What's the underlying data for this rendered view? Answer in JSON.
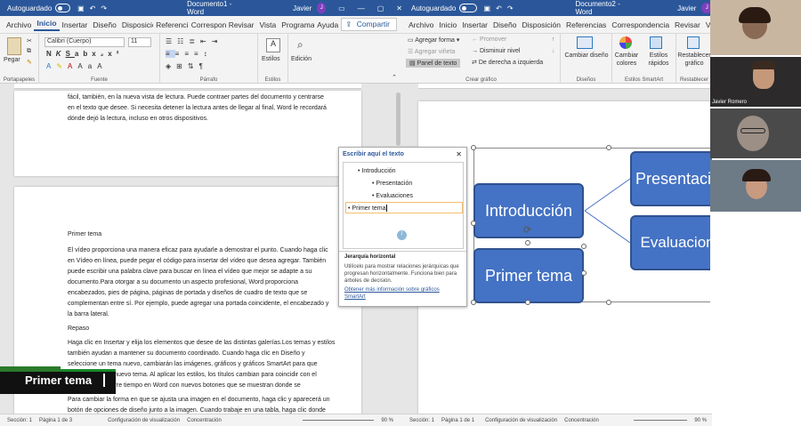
{
  "left": {
    "autosave": "Autoguardado",
    "doc_title": "Documento1 - Word",
    "user": "Javier",
    "user_initial": "J",
    "tabs": [
      "Archivo",
      "Inicio",
      "Insertar",
      "Diseño",
      "Disposición",
      "Referencias",
      "Correspondencia",
      "Revisar",
      "Vista",
      "Programador",
      "Ayuda"
    ],
    "active_tab": "Inicio",
    "share": "Compartir",
    "ribbon": {
      "paste": "Pegar",
      "font": "Calibri (Cuerpo)",
      "size": "11",
      "styles": "Estilos",
      "edit": "Edición",
      "groups": [
        "Portapapeles",
        "Fuente",
        "Párrafo",
        "Estilos"
      ]
    },
    "doc_top_lines": [
      "fácil, también, en la nueva vista de lectura. Puede contraer partes del documento y centrarse",
      "en el texto que desee. Si necesita detener la lectura antes de llegar al final, Word le recordará",
      "dónde dejó la lectura, incluso en otros dispositivos."
    ],
    "heading1": "Primer tema",
    "para1": [
      "El vídeo proporciona una manera eficaz para ayudarle a demostrar el punto. Cuando haga clic",
      "en Vídeo en línea, puede pegar el código para insertar del vídeo que desea agregar. También",
      "puede escribir una palabra clave para buscar en línea el vídeo que mejor se adapte a su",
      "documento.Para otorgar a su documento un aspecto profesional, Word proporciona",
      "encabezados, pies de página, páginas de portada y diseños de cuadro de texto que se",
      "complementan entre sí. Por ejemplo, puede agregar una portada coincidente, el encabezado y",
      "la barra lateral."
    ],
    "heading2": "Repaso",
    "para2": [
      "Haga clic en Insertar y elija los elementos que desee de las distintas galerías.Los temas y estilos",
      "también ayudan a mantener su documento coordinado. Cuando haga clic en Diseño y",
      "seleccione un tema nuevo, cambiarán las imágenes, gráficos y gráficos SmartArt para que",
      "coincidan con el nuevo tema. Al aplicar los estilos, los títulos cambian para coincidir con el",
      "nuevo tema. Ahorre tiempo en Word con nuevos botones que se muestran donde se",
      "",
      "Para cambiar la forma en que se ajusta una imagen en el documento, haga clic y aparecerá un",
      "botón de opciones de diseño junto a la imagen. Cuando trabaje en una tabla, haga clic donde"
    ],
    "status": [
      "Sección: 1",
      "Página 1 de 3",
      "Configuración de visualización",
      "Concentración",
      "90 %"
    ]
  },
  "caption": "Primer tema",
  "text_pane": {
    "title": "Escribir aquí el texto",
    "items": [
      {
        "level": 1,
        "text": "Introducción"
      },
      {
        "level": 2,
        "text": "Presentación"
      },
      {
        "level": 2,
        "text": "Evaluaciones"
      },
      {
        "level": 1,
        "text": "Primer tema"
      }
    ],
    "desc_title": "Jerarquía horizontal",
    "desc_text": "Utilícelo para mostrar relaciones jerárquicas que progresan horizontalmente. Funciona bien para árboles de decisión.",
    "link": "Obtener más información sobre gráficos SmartArt"
  },
  "right": {
    "autosave": "Autoguardado",
    "doc_title": "Documento2 - Word",
    "user": "Javier",
    "user_initial": "J",
    "tabs": [
      "Archivo",
      "Inicio",
      "Insertar",
      "Diseño",
      "Disposición",
      "Referencias",
      "Correspondencia",
      "Revisar",
      "Vista"
    ],
    "ribbon": {
      "add_shape": "Agregar forma",
      "add_bullet": "Agregar viñeta",
      "text_pane": "Panel de texto",
      "promote": "Promover",
      "demote": "Disminuir nivel",
      "rtl": "De derecha a izquierda",
      "change_layout": "Cambiar diseño",
      "change_colors": "Cambiar colores",
      "quick_styles": "Estilos rápidos",
      "reset": "Restablecer gráfico",
      "groups": [
        "Crear gráfico",
        "Diseños",
        "Estilos SmartArt",
        "Restablecer"
      ]
    },
    "smartart": {
      "root": "Introducción",
      "root2": "Primer tema",
      "child1": "Presentación",
      "child2": "Evaluaciones"
    },
    "status": [
      "Sección: 1",
      "Página 1 de 1",
      "Configuración de visualización",
      "Concentración",
      "90 %"
    ]
  },
  "participants": [
    {
      "name": ""
    },
    {
      "name": "Javier Romero"
    },
    {
      "name": ""
    },
    {
      "name": ""
    }
  ]
}
